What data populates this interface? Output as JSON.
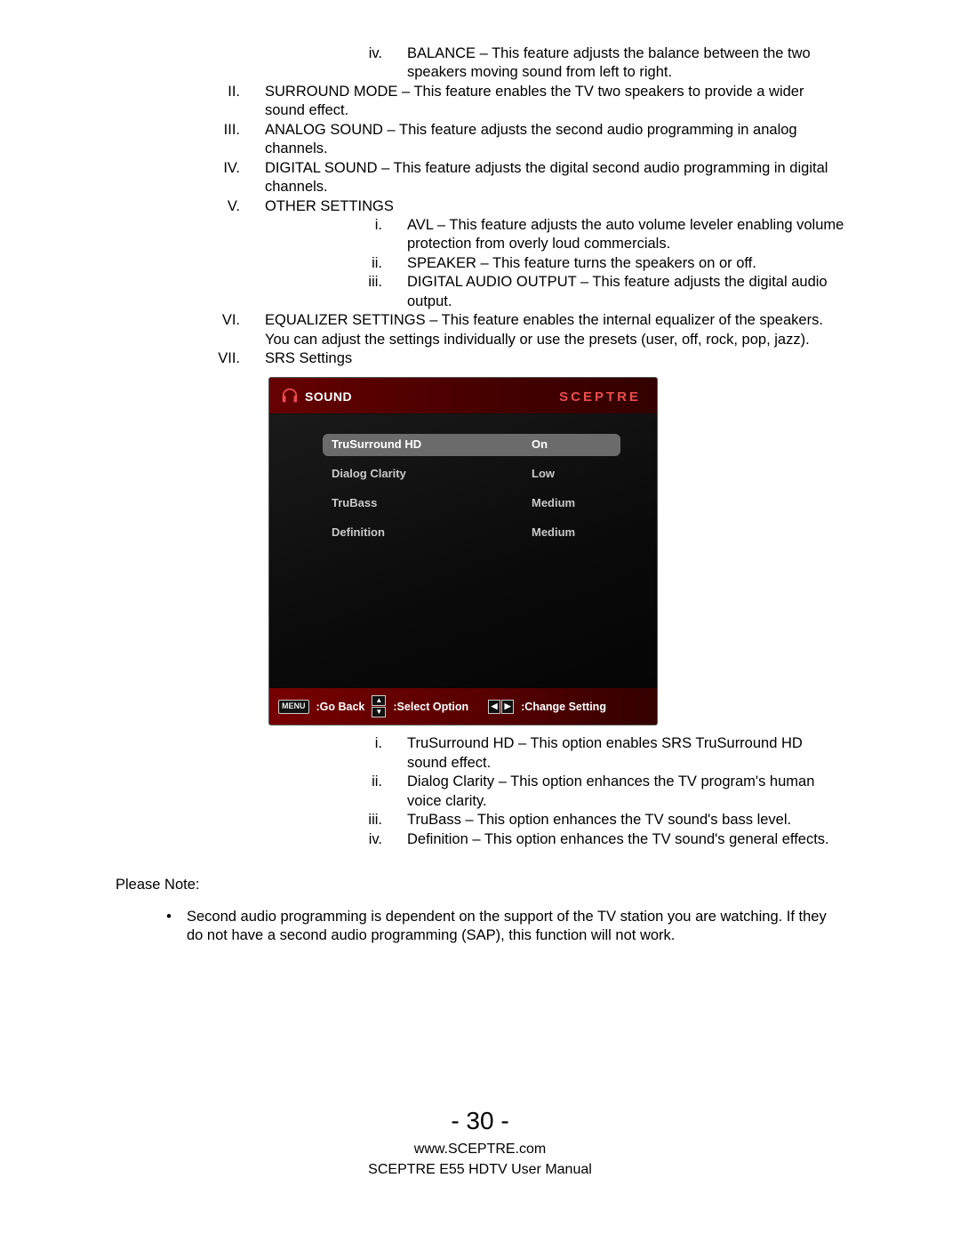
{
  "list": {
    "iv": {
      "n": "iv.",
      "t": "BALANCE – This feature adjusts the balance between the two speakers moving sound from left to right."
    },
    "II": {
      "n": "II.",
      "t": "SURROUND MODE – This feature enables the TV two speakers to provide a wider sound effect."
    },
    "III": {
      "n": "III.",
      "t": "ANALOG SOUND – This feature adjusts the second audio programming in analog channels."
    },
    "IV": {
      "n": "IV.",
      "t": "DIGITAL SOUND – This feature adjusts the digital second audio programming in digital channels."
    },
    "V": {
      "n": "V.",
      "t": "OTHER SETTINGS"
    },
    "V_i": {
      "n": "i.",
      "t": "AVL – This feature adjusts the auto volume leveler enabling volume protection from overly loud commercials."
    },
    "V_ii": {
      "n": "ii.",
      "t": "SPEAKER – This feature turns the speakers on or off."
    },
    "V_iii": {
      "n": "iii.",
      "t": "DIGITAL AUDIO OUTPUT – This feature adjusts the digital audio output."
    },
    "VI": {
      "n": "VI.",
      "t": "EQUALIZER SETTINGS – This feature enables the internal equalizer of the speakers.  You can adjust the settings individually or use the presets (user, off, rock, pop, jazz)."
    },
    "VII": {
      "n": "VII.",
      "t": "SRS Settings"
    },
    "VII_i": {
      "n": "i.",
      "t": "TruSurround HD – This option enables SRS TruSurround HD sound effect."
    },
    "VII_ii": {
      "n": "ii.",
      "t": "Dialog Clarity – This option enhances the TV program's human voice clarity."
    },
    "VII_iii": {
      "n": "iii.",
      "t": "TruBass – This option enhances the TV sound's bass level."
    },
    "VII_iv": {
      "n": "iv.",
      "t": "Definition – This option enhances the TV sound's general effects."
    }
  },
  "osd": {
    "title": "SOUND",
    "brand": "SCEPTRE",
    "rows": {
      "r0": {
        "label": "TruSurround HD",
        "val": "On"
      },
      "r1": {
        "label": "Dialog Clarity",
        "val": "Low"
      },
      "r2": {
        "label": "TruBass",
        "val": "Medium"
      },
      "r3": {
        "label": "Definition",
        "val": "Medium"
      }
    },
    "footer": {
      "menu": "MENU",
      "back": ":Go Back",
      "select": ":Select Option",
      "change": ":Change Setting"
    }
  },
  "note": {
    "label": "Please Note:",
    "bullet": "•",
    "text": "Second audio programming is dependent on the support of the TV station you are watching.  If they do not have a second audio programming (SAP), this function will not work."
  },
  "footer": {
    "page": "- 30 -",
    "url": "www.SCEPTRE.com",
    "model": "SCEPTRE E55 HDTV User Manual"
  }
}
